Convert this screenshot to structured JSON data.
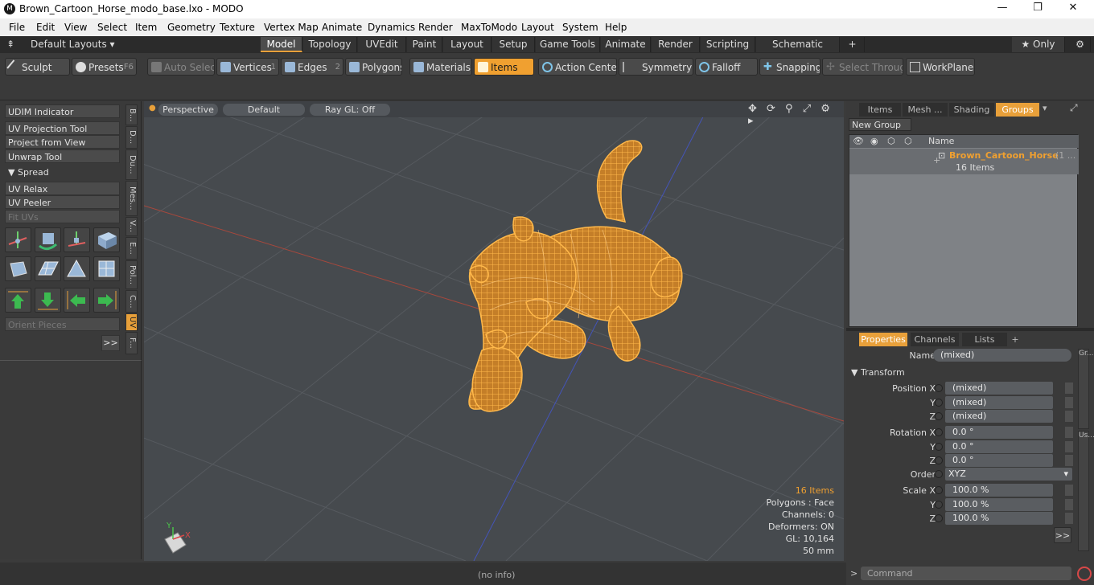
{
  "window": {
    "title": "Brown_Cartoon_Horse_modo_base.lxo - MODO",
    "logo": "modo-logo",
    "minimize": "—",
    "maximize": "❐",
    "close": "✕"
  },
  "menu": [
    "File",
    "Edit",
    "View",
    "Select",
    "Item",
    "Geometry",
    "Texture",
    "Vertex Map",
    "Animate",
    "Dynamics",
    "Render",
    "MaxToModo",
    "Layout",
    "System",
    "Help"
  ],
  "layouts": {
    "label": "Default Layouts ▾",
    "tabs": [
      "Model",
      "Topology",
      "UVEdit",
      "Paint",
      "Layout",
      "Setup",
      "Game Tools",
      "Animate",
      "Render",
      "Scripting",
      "Schematic Fusion",
      "+"
    ],
    "active": "Model",
    "only": "★ Only",
    "gear": "⚙"
  },
  "toolbar": {
    "sculpt": "Sculpt",
    "presets": "Presets",
    "presets_key": "F6",
    "auto_select": "Auto Select",
    "vertices": "Vertices",
    "vertices_num": "1",
    "edges": "Edges",
    "edges_num": "2",
    "polygons": "Polygons",
    "materials": "Materials",
    "items": "Items",
    "action_center": "Action Center",
    "symmetry": "Symmetry",
    "falloff": "Falloff",
    "snapping": "Snapping",
    "select_through": "Select Through",
    "workplane": "WorkPlane"
  },
  "left": {
    "udim": "UDIM Indicator",
    "uv_proj": "UV Projection Tool",
    "proj_view": "Project from View",
    "unwrap": "Unwrap Tool",
    "spread": "Spread",
    "uv_relax": "UV Relax",
    "uv_peeler": "UV Peeler",
    "fit_uvs": "Fit UVs",
    "orient": "Orient Pieces",
    "more": ">>",
    "vtabs": [
      "B...",
      "D...",
      "Du...",
      "Mes...",
      "V...",
      "E...",
      "Pol...",
      "C...",
      "UV",
      "F..."
    ]
  },
  "viewport": {
    "perspective": "Perspective",
    "default": "Default",
    "raygl": "Ray GL: Off",
    "nav_icons": "✥ ⟳ ⚲ ⤢ ⚙ ▸",
    "stats": {
      "items": "16 Items",
      "polygons": "Polygons : Face",
      "channels": "Channels: 0",
      "deformers": "Deformers: ON",
      "gl": "GL: 10,164",
      "mm": "50 mm"
    },
    "axis_x": "X",
    "axis_y": "Y"
  },
  "right": {
    "tabs": [
      "Items",
      "Mesh ...",
      "Shading",
      "Groups"
    ],
    "active_tab": "Groups",
    "new_group": "New Group",
    "col_name": "Name",
    "group": {
      "name": "Brown_Cartoon_Horse",
      "suffix": "(1 ...",
      "count": "16 Items"
    },
    "ptabs": [
      "Properties",
      "Channels",
      "Lists",
      "+"
    ],
    "active_ptab": "Properties",
    "props": {
      "name_label": "Name",
      "name_val": "(mixed)",
      "transform": "Transform",
      "pos_label": "Position X",
      "px": "(mixed)",
      "py": "(mixed)",
      "pz": "(mixed)",
      "rot_label": "Rotation X",
      "rx": "0.0 °",
      "ry": "0.0 °",
      "rz": "0.0 °",
      "order_label": "Order",
      "order_val": "XYZ",
      "scale_label": "Scale X",
      "sx": "100.0 %",
      "sy": "100.0 %",
      "sz": "100.0 %",
      "y": "Y",
      "z": "Z",
      "more": ">>"
    },
    "side_tabs": [
      "Gr...",
      "Us..."
    ]
  },
  "status": {
    "info": "(no info)",
    "command": "Command",
    "prompt": ">"
  }
}
